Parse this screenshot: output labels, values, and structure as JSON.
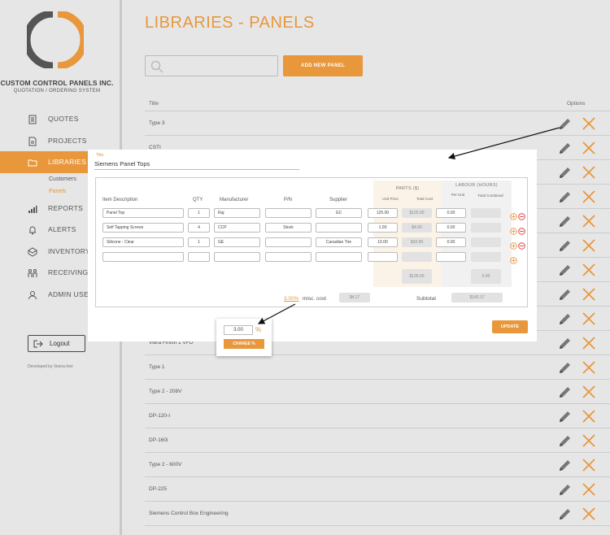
{
  "sidebar": {
    "company": "CUSTOM CONTROL PANELS INC.",
    "tagline": "QUOTATION / ORDERING SYSTEM",
    "items": [
      {
        "label": "QUOTES",
        "icon": "quotes-icon"
      },
      {
        "label": "PROJECTS",
        "icon": "projects-icon"
      },
      {
        "label": "LIBRARIES",
        "icon": "folder-icon",
        "active": true
      },
      {
        "label": "REPORTS",
        "icon": "bar-chart-icon"
      },
      {
        "label": "ALERTS",
        "icon": "bell-icon"
      },
      {
        "label": "INVENTORY",
        "icon": "inventory-icon"
      },
      {
        "label": "RECEIVING I",
        "icon": "receiving-icon"
      },
      {
        "label": "ADMIN USE",
        "icon": "user-icon"
      }
    ],
    "sub_items": [
      "Customers",
      "Panels"
    ],
    "logout": "Logout",
    "developer": "Developed by Vesna Inet"
  },
  "main": {
    "title": "LIBRARIES - PANELS",
    "search_placeholder": "",
    "add_button": "ADD NEW PANEL",
    "col_title": "Title",
    "col_options": "Options",
    "rows": [
      "Type 3",
      "CSTI",
      "",
      "",
      "",
      "",
      "",
      "",
      "",
      "Vibra Finish 1 VFD",
      "Type 1",
      "Type 2 - 208V",
      "DP-120-I",
      "DP-160i",
      "Type 2 - 600V",
      "DP-225",
      "Siemens Control Box Engineering"
    ]
  },
  "modal": {
    "title_label": "Title",
    "title_value": "Siemens Panel Tops",
    "group_parts": "PARTS ($)",
    "group_labour": "LABOUR (HOURS)",
    "headers": {
      "item": "Item Description",
      "qty": "QTY",
      "manufacturer": "Manufacturer",
      "pn": "P/N",
      "supplier": "Supplier",
      "unit_price": "Unit Price",
      "total_cost": "Total Cost",
      "per_unit": "Per Unit",
      "total_combined": "Total Combined"
    },
    "items": [
      {
        "desc": "Panel Top",
        "qty": "1",
        "mfr": "Raj",
        "pn": "",
        "supplier": "GC",
        "unit": "125.00",
        "total": "$125.00",
        "per": "0.00",
        "tc": ""
      },
      {
        "desc": "Self Tapping Screws",
        "qty": "4",
        "mfr": "CCP",
        "pn": "Stock",
        "supplier": "",
        "unit": "1.00",
        "total": "$4.00",
        "per": "0.00",
        "tc": ""
      },
      {
        "desc": "Silicone - Clear",
        "qty": "1",
        "mfr": "GE",
        "pn": "",
        "supplier": "Canadian Tire",
        "unit": "10.00",
        "total": "$10.00",
        "per": "0.00",
        "tc": ""
      },
      {
        "desc": "",
        "qty": "",
        "mfr": "",
        "pn": "",
        "supplier": "",
        "unit": "",
        "total": "",
        "per": "",
        "tc": ""
      }
    ],
    "parts_total": "$139.00",
    "labour_total": "0.00",
    "misc_link": "3.00%",
    "misc_label": "misc. cost",
    "misc_value": "$4.17",
    "subtotal_label": "Subtotal",
    "subtotal_value": "$143.17",
    "update_button": "UPDATE"
  },
  "popup": {
    "value": "3.00",
    "symbol": "%",
    "button": "CHANGE %"
  },
  "colors": {
    "accent": "#e8973b",
    "text": "#333333",
    "background": "#e6e6e6"
  }
}
